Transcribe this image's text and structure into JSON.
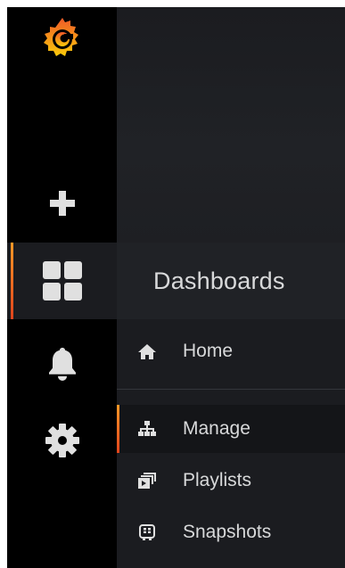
{
  "sidemenu": {
    "logo_icon": "grafana-logo-icon",
    "items": [
      {
        "name": "create",
        "icon": "plus-icon"
      },
      {
        "name": "dashboards",
        "icon": "dashboards-grid-icon",
        "active": true
      },
      {
        "name": "alerting",
        "icon": "bell-icon"
      },
      {
        "name": "configuration",
        "icon": "gear-icon"
      }
    ]
  },
  "dropdown": {
    "title": "Dashboards",
    "items": [
      {
        "label": "Home",
        "icon": "home-icon"
      },
      {
        "label": "Manage",
        "icon": "sitemap-icon",
        "active": true
      },
      {
        "label": "Playlists",
        "icon": "playlist-icon"
      },
      {
        "label": "Snapshots",
        "icon": "snapshot-icon"
      }
    ]
  },
  "colors": {
    "accent_start": "#f99827",
    "accent_end": "#e0441c",
    "text": "#d8d9da",
    "sidemenu_bg": "#000000"
  }
}
